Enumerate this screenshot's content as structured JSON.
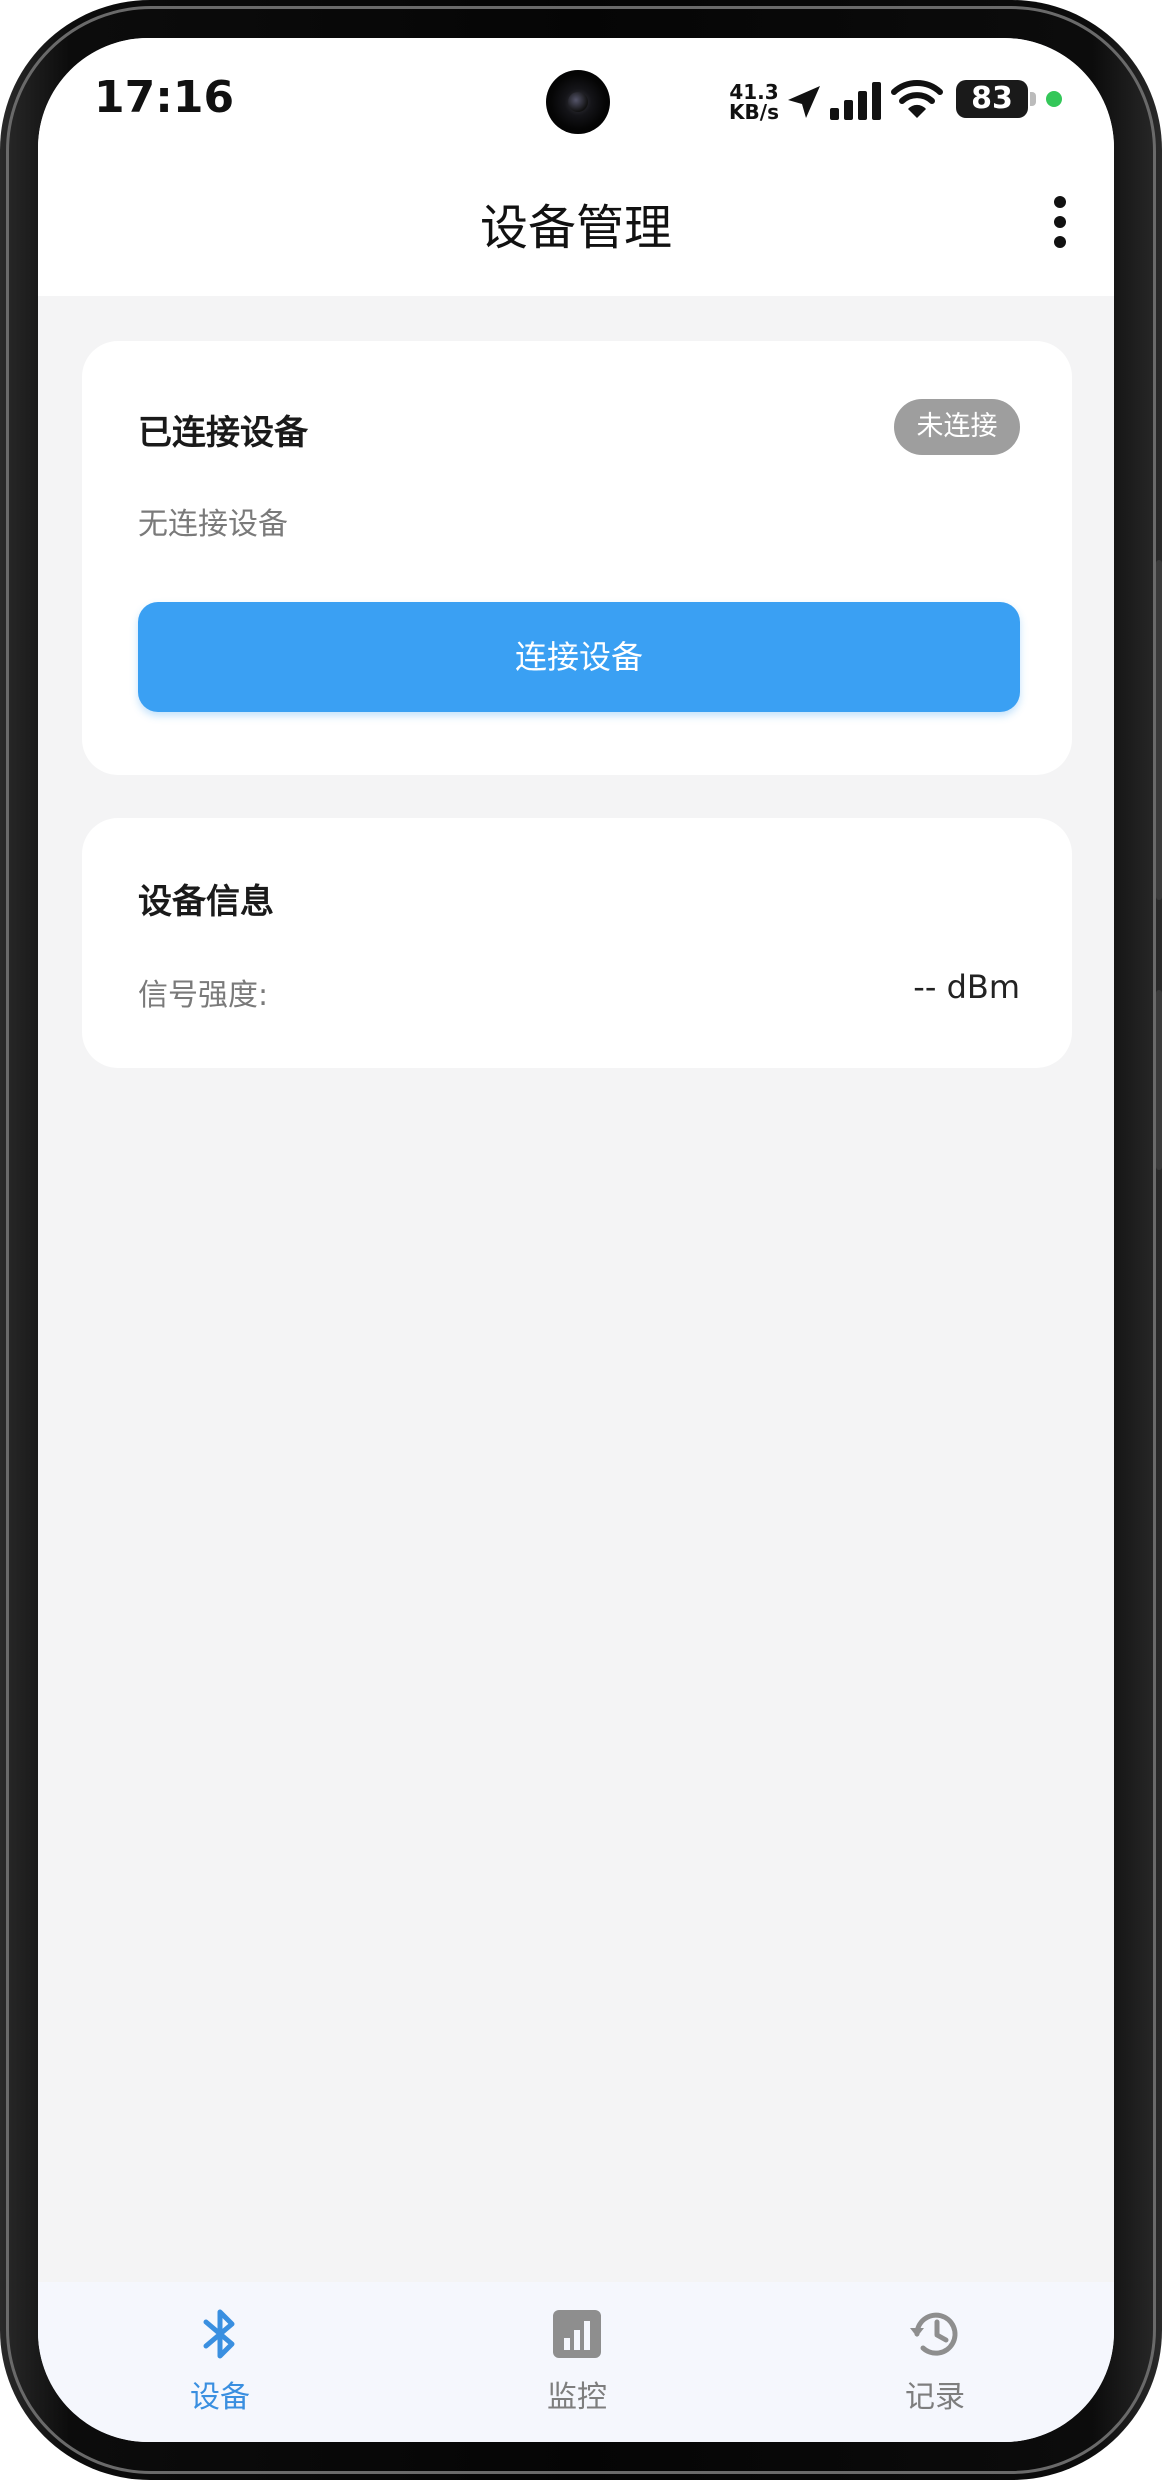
{
  "status_bar": {
    "time": "17:16",
    "net_speed_value": "41.3",
    "net_speed_unit": "KB/s",
    "battery_level": "83",
    "privacy_dot_color": "#34c759"
  },
  "app_bar": {
    "title": "设备管理",
    "more_icon": "more-vertical-icon"
  },
  "connected_card": {
    "title": "已连接设备",
    "status_badge": "未连接",
    "empty_text": "无连接设备",
    "connect_button": "连接设备"
  },
  "info_card": {
    "title": "设备信息",
    "signal_label": "信号强度:",
    "signal_value": "-- dBm"
  },
  "bottom_nav": {
    "items": [
      {
        "label": "设备",
        "icon": "bluetooth-icon",
        "active": true
      },
      {
        "label": "监控",
        "icon": "bar-chart-icon",
        "active": false
      },
      {
        "label": "记录",
        "icon": "history-icon",
        "active": false
      }
    ]
  },
  "colors": {
    "accent": "#3aa0f3",
    "nav_active": "#3a8fe0",
    "badge_inactive": "#9e9e9e",
    "background": "#f4f4f5"
  }
}
